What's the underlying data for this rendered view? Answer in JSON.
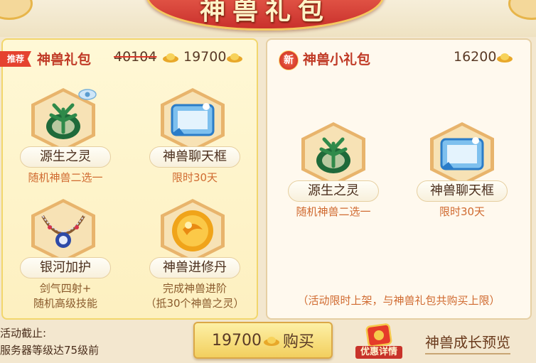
{
  "header": {
    "title": "神兽礼包"
  },
  "left_package": {
    "badge": "推荐",
    "title": "神兽礼包",
    "original_price": "40104",
    "price": "19700",
    "items": [
      {
        "name": "源生之灵",
        "sub": [
          "随机神兽二选一"
        ],
        "icon": "green-spirit-icon"
      },
      {
        "name": "神兽聊天框",
        "sub": [
          "限时30天"
        ],
        "icon": "chat-frame-icon"
      },
      {
        "name": "银河加护",
        "sub": [
          "剑气四射+",
          "随机高级技能"
        ],
        "icon": "galaxy-necklace-icon"
      },
      {
        "name": "神兽进修丹",
        "sub": [
          "完成神兽进阶",
          "（抵30个神兽之灵）"
        ],
        "icon": "golden-pill-icon"
      }
    ]
  },
  "right_package": {
    "badge": "新",
    "title": "神兽小礼包",
    "price": "16200",
    "items": [
      {
        "name": "源生之灵",
        "sub": [
          "随机神兽二选一"
        ],
        "icon": "green-spirit-icon"
      },
      {
        "name": "神兽聊天框",
        "sub": [
          "限时30天"
        ],
        "icon": "chat-frame-icon"
      }
    ],
    "note": "（活动限时上架，与神兽礼包共购买上限）"
  },
  "footer": {
    "deadline_label": "活动截止:",
    "deadline_value": "服务器等级达75级前",
    "buy_price": "19700",
    "buy_label": "购买",
    "promo_label": "优惠详情",
    "growth_link": "神兽成长预览"
  }
}
